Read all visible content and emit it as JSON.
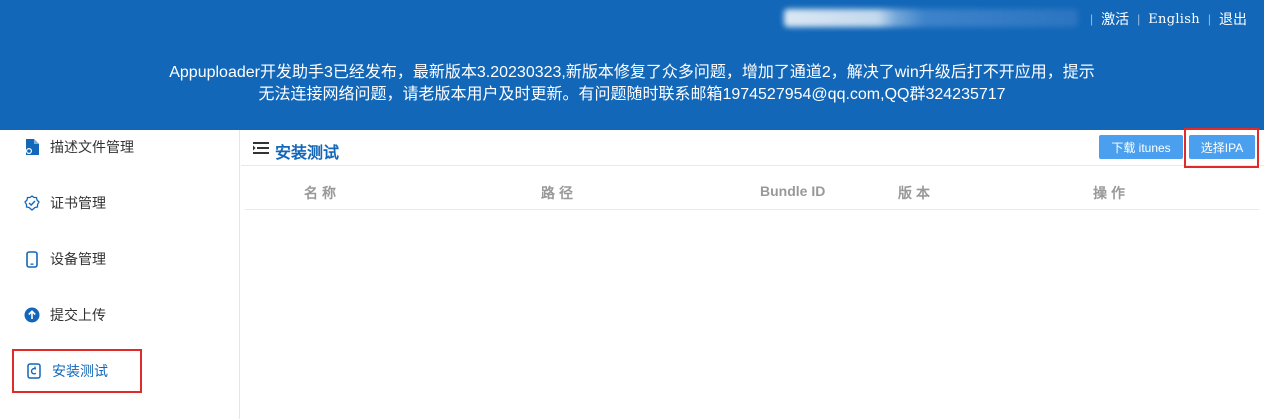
{
  "header": {
    "links": {
      "activate": "激活",
      "language": "English",
      "logout": "退出"
    },
    "notice_line1": "Appuploader开发助手3已经发布，最新版本3.20230323,新版本修复了众多问题，增加了通道2，解决了win升级后打不开应用，提示",
    "notice_line2": "无法连接网络问题，请老版本用户及时更新。有问题随时联系邮箱1974527954@qq.com,QQ群324235717"
  },
  "sidebar": {
    "items": [
      {
        "label": "描述文件管理",
        "icon": "file-icon"
      },
      {
        "label": "证书管理",
        "icon": "certificate-icon"
      },
      {
        "label": "设备管理",
        "icon": "phone-icon"
      },
      {
        "label": "提交上传",
        "icon": "upload-icon"
      },
      {
        "label": "安装测试",
        "icon": "install-icon",
        "active": true
      }
    ]
  },
  "main": {
    "title": "安装测试",
    "buttons": {
      "itunes": "下载 itunes",
      "select_ipa": "选择IPA"
    },
    "columns": [
      "名称",
      "路径",
      "Bundle ID",
      "版本",
      "操作"
    ]
  },
  "colors": {
    "header_bg": "#1267b8",
    "accent": "#1267b8",
    "button": "#4aa0ee",
    "highlight": "#e02b2b"
  }
}
